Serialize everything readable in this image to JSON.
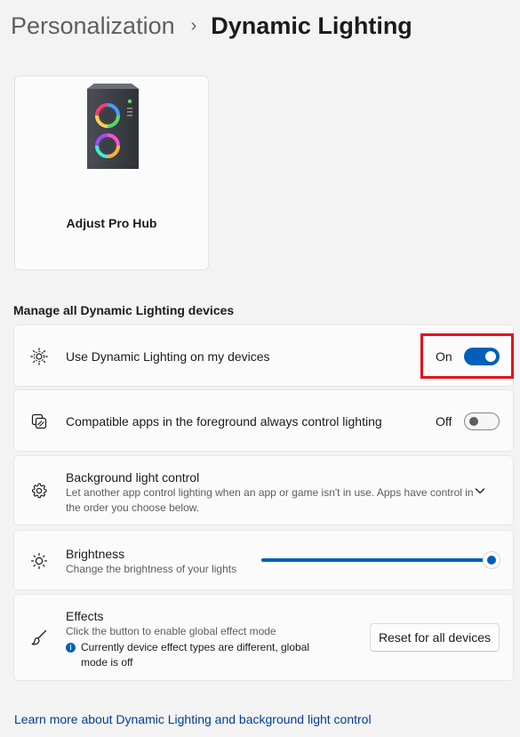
{
  "breadcrumb": {
    "parent": "Personalization",
    "separator": "›",
    "current": "Dynamic Lighting"
  },
  "device": {
    "name": "Adjust Pro Hub",
    "icon": "pc-tower-rgb-icon"
  },
  "section_title": "Manage all Dynamic Lighting devices",
  "settings": {
    "use_dynamic_lighting": {
      "title": "Use Dynamic Lighting on my devices",
      "state_label": "On",
      "state": true,
      "icon": "lighting-sun-icon"
    },
    "compatible_apps": {
      "title": "Compatible apps in the foreground always control lighting",
      "state_label": "Off",
      "state": false,
      "icon": "apps-control-icon"
    },
    "background_light": {
      "title": "Background light control",
      "description": "Let another app control lighting when an app or game isn't in use. Apps have control in the order you choose below.",
      "icon": "gear-icon"
    },
    "brightness": {
      "title": "Brightness",
      "description": "Change the brightness of your lights",
      "value_fraction": 1.0,
      "icon": "brightness-icon"
    },
    "effects": {
      "title": "Effects",
      "description": "Click the button to enable global effect mode",
      "info": "Currently device effect types are different, global mode is off",
      "button_label": "Reset for all devices",
      "icon": "brush-icon"
    }
  },
  "learn_more_link": "Learn more about Dynamic Lighting and background light control",
  "colors": {
    "accent": "#005fb8",
    "highlight": "#e3121c",
    "link": "#003e92"
  }
}
